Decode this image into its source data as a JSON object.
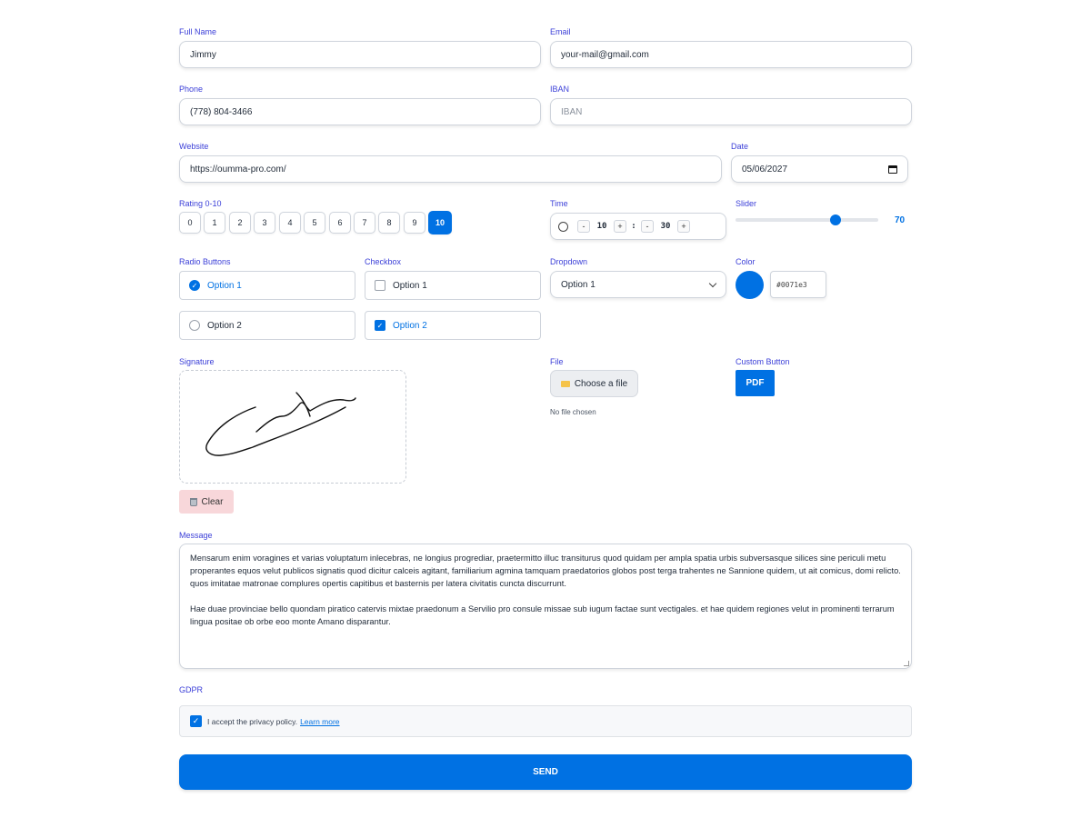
{
  "full_name": {
    "label": "Full Name",
    "value": "Jimmy"
  },
  "email": {
    "label": "Email",
    "value": "your-mail@gmail.com"
  },
  "phone": {
    "label": "Phone",
    "value": "(778) 804-3466"
  },
  "iban": {
    "label": "IBAN",
    "placeholder": "IBAN"
  },
  "website": {
    "label": "Website",
    "value": "https://oumma-pro.com/"
  },
  "date": {
    "label": "Date",
    "value": "05/06/2027"
  },
  "rating": {
    "label": "Rating 0-10",
    "options": [
      "0",
      "1",
      "2",
      "3",
      "4",
      "5",
      "6",
      "7",
      "8",
      "9",
      "10"
    ],
    "selected": "10"
  },
  "time": {
    "label": "Time",
    "minus": "-",
    "plus": "+",
    "hours": "10",
    "sep": ":",
    "minutes": "30"
  },
  "slider": {
    "label": "Slider",
    "value": "70",
    "fraction": 0.7
  },
  "radio": {
    "label": "Radio Buttons",
    "options": [
      "Option 1",
      "Option 2"
    ],
    "selected": "Option 1"
  },
  "checkbox": {
    "label": "Checkbox",
    "options": [
      "Option 1",
      "Option 2"
    ],
    "checked": [
      "Option 2"
    ]
  },
  "dropdown": {
    "label": "Dropdown",
    "value": "Option 1"
  },
  "color": {
    "label": "Color",
    "value": "#0071e3"
  },
  "signature": {
    "label": "Signature",
    "clear_label": "Clear"
  },
  "file": {
    "label": "File",
    "button_label": "Choose a file",
    "status": "No file chosen"
  },
  "custom_button": {
    "label": "Custom Button",
    "button_label": "PDF"
  },
  "message": {
    "label": "Message",
    "para1": "Mensarum enim voragines et varias voluptatum inlecebras, ne longius progrediar, praetermitto illuc transiturus quod quidam per ampla spatia urbis subversasque silices sine periculi metu properantes equos velut publicos signatis quod dicitur calceis agitant, familiarium agmina tamquam praedatorios globos post terga trahentes ne Sannione quidem, ut ait comicus, domi relicto. quos imitatae matronae complures opertis capitibus et basternis per latera civitatis cuncta discurrunt.",
    "para2": "Hae duae provinciae bello quondam piratico catervis mixtae praedonum a Servilio pro consule missae sub iugum factae sunt vectigales. et hae quidem regiones velut in prominenti terrarum lingua positae ob orbe eoo monte Amano disparantur."
  },
  "gdpr": {
    "label": "GDPR",
    "text": "I accept the privacy policy.",
    "link": "Learn more",
    "checked": true
  },
  "send_label": "SEND",
  "colors": {
    "accent": "#0071e3",
    "label": "#3b3fd8",
    "clear_bg": "#f8d7da"
  }
}
